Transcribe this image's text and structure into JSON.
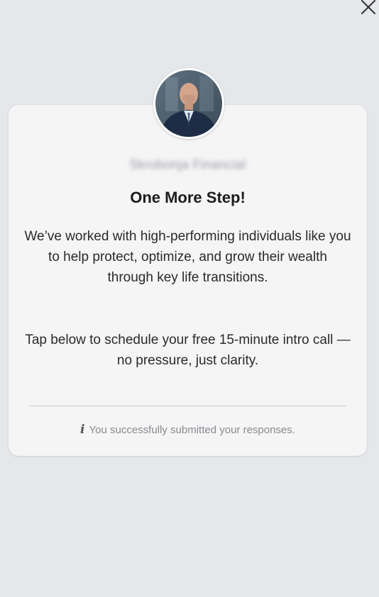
{
  "modal": {
    "business_name": "Skrobonja Financial",
    "title": "One More Step!",
    "paragraph_1": "We’ve worked with high-performing individuals like you to help protect, optimize, and grow their wealth through key life transitions.",
    "paragraph_2": "Tap below to schedule your free 15-minute intro call — no pressure, just clarity.",
    "status_icon": "i",
    "status_message": "You successfully submitted your responses."
  },
  "icons": {
    "close": "close-icon",
    "info": "info-icon",
    "avatar": "advisor-avatar"
  },
  "colors": {
    "page_background": "#e6e7ea",
    "card_background": "#f5f5f6",
    "title_text": "#1c1c1e",
    "muted_text": "#8a8a90"
  }
}
